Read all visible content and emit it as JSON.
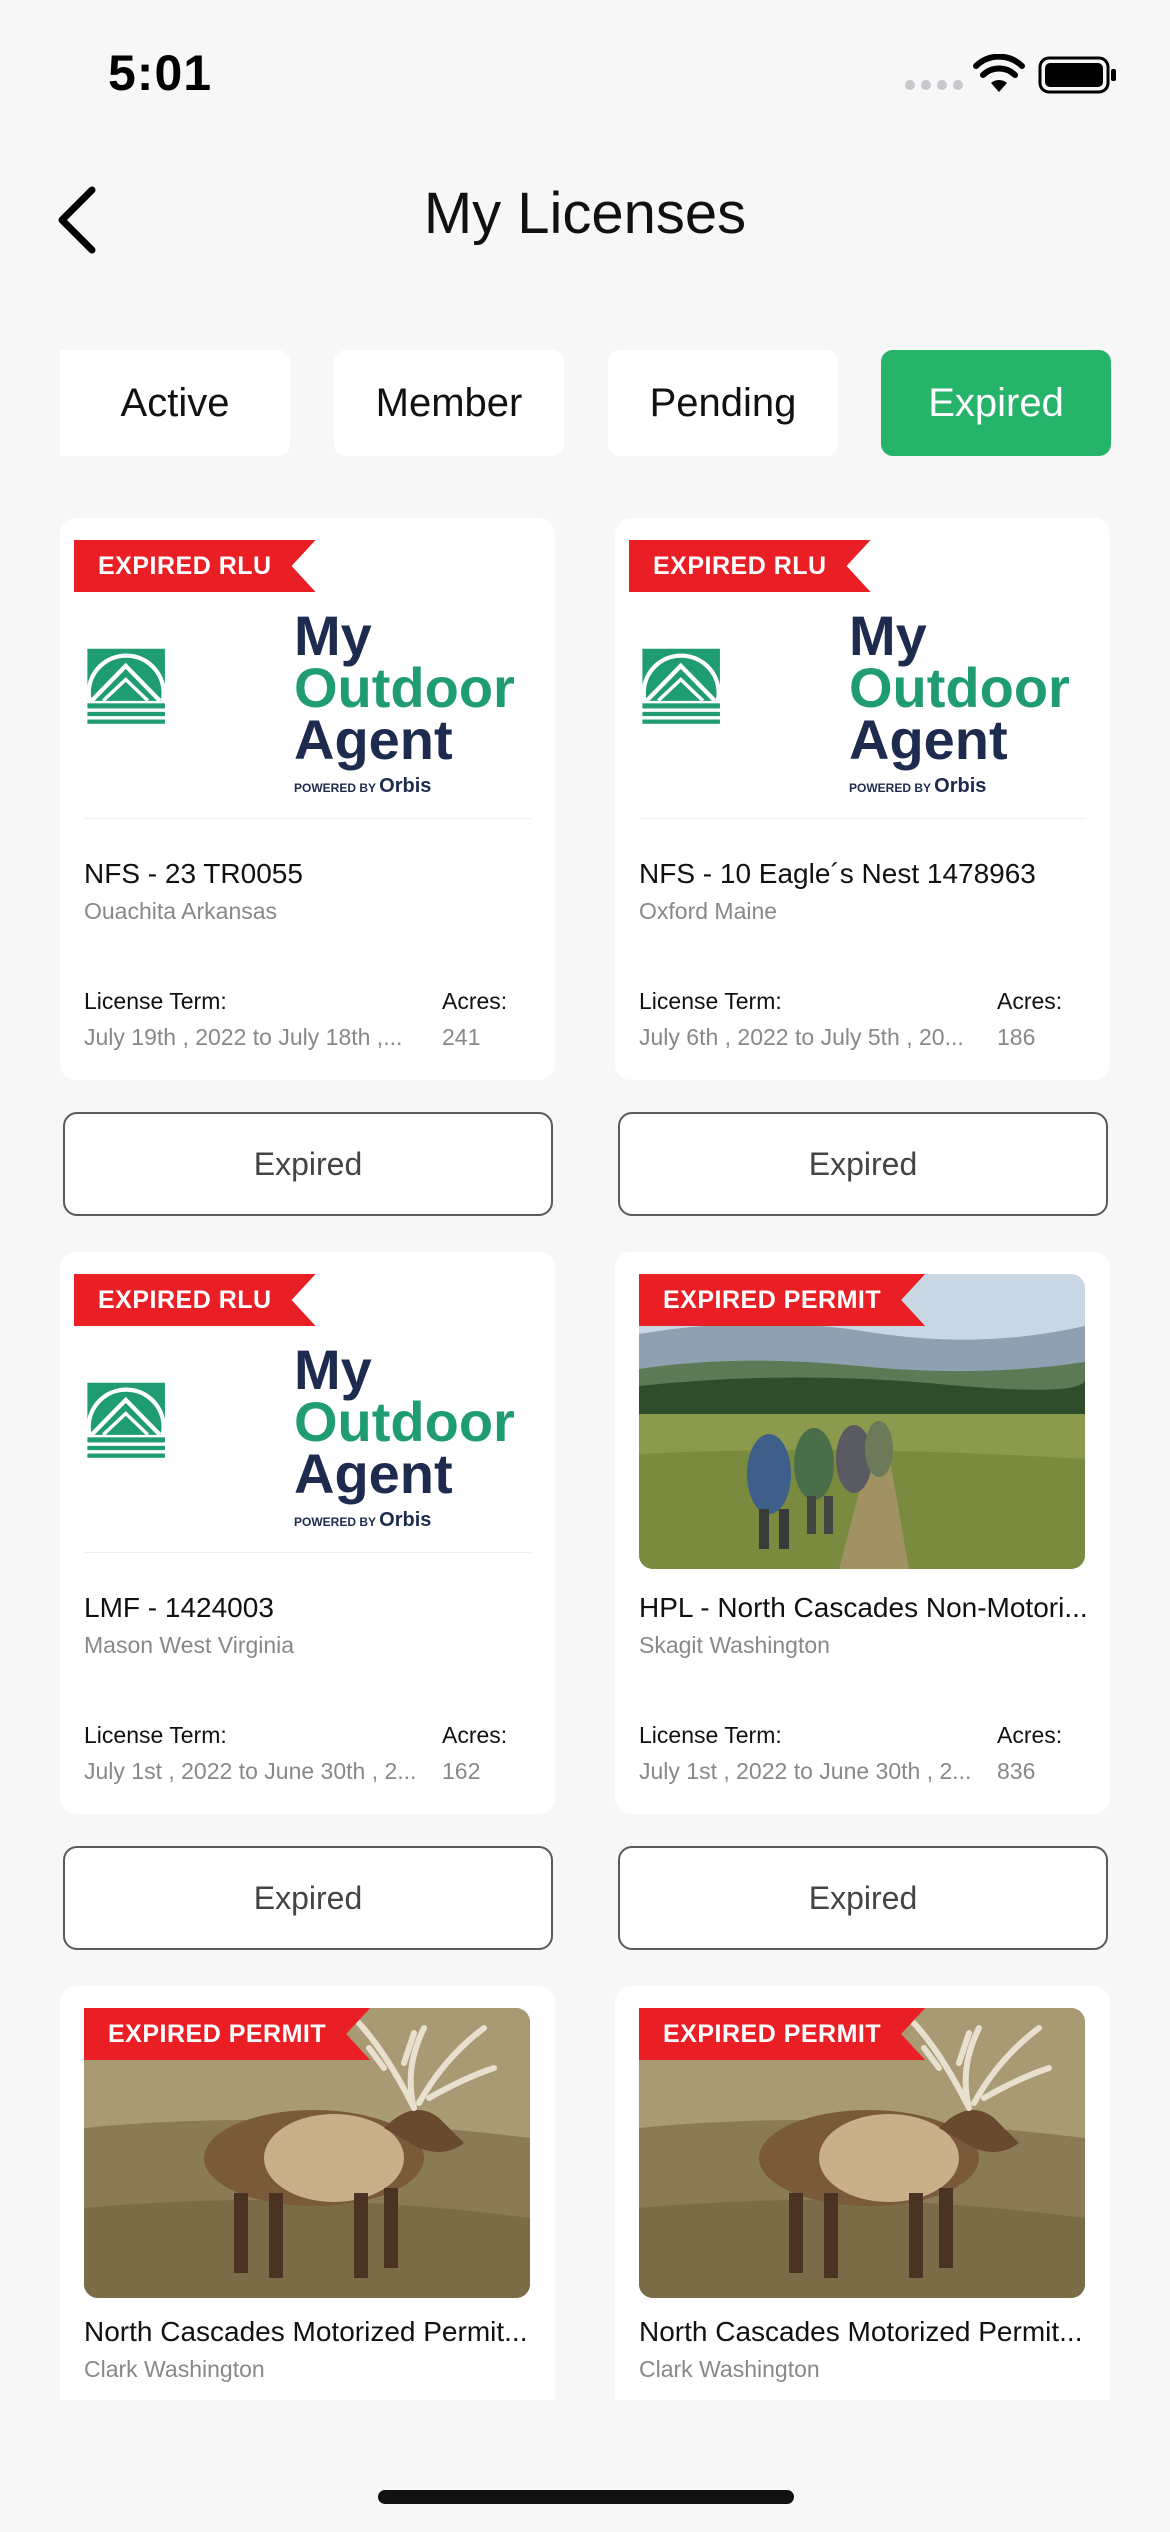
{
  "status_bar": {
    "time": "5:01"
  },
  "header": {
    "title": "My Licenses"
  },
  "tabs": [
    {
      "label": "Active"
    },
    {
      "label": "Member"
    },
    {
      "label": "Pending"
    },
    {
      "label": "Expired",
      "selected": true
    }
  ],
  "colors": {
    "accent": "#26b36a",
    "ribbon": "#ea1f25",
    "logo_green": "#1f9c74",
    "logo_navy": "#1d2b4f"
  },
  "logo": {
    "line1": "My",
    "line2": "Outdoor",
    "line3": "Agent",
    "powered": "POWERED BY",
    "brand": "Orbis"
  },
  "cards": [
    {
      "ribbon": "EXPIRED RLU",
      "image": "my-outdoor-agent-logo",
      "title": "NFS - 23 TR0055",
      "location": "Ouachita Arkansas",
      "term_label": "License Term:",
      "term": "July 19th , 2022 to July 18th ,...",
      "acres_label": "Acres:",
      "acres": "241",
      "status": "Expired"
    },
    {
      "ribbon": "EXPIRED RLU",
      "image": "my-outdoor-agent-logo",
      "title": "NFS - 10 Eagle´s Nest 1478963",
      "location": "Oxford Maine",
      "term_label": "License Term:",
      "term": "July 6th , 2022 to July 5th , 20...",
      "acres_label": "Acres:",
      "acres": "186",
      "status": "Expired"
    },
    {
      "ribbon": "EXPIRED RLU",
      "image": "my-outdoor-agent-logo",
      "title": "LMF - 1424003",
      "location": "Mason West Virginia",
      "term_label": "License Term:",
      "term": "July 1st , 2022 to June 30th , 2...",
      "acres_label": "Acres:",
      "acres": "162",
      "status": "Expired"
    },
    {
      "ribbon": "EXPIRED PERMIT",
      "image": "hikers-photo",
      "title": "HPL - North Cascades Non-Motori...",
      "location": "Skagit Washington",
      "term_label": "License Term:",
      "term": "July 1st , 2022 to June 30th , 2...",
      "acres_label": "Acres:",
      "acres": "836",
      "status": "Expired"
    },
    {
      "ribbon": "EXPIRED PERMIT",
      "image": "elk-photo",
      "title": "North Cascades Motorized Permit...",
      "location": "Clark Washington"
    },
    {
      "ribbon": "EXPIRED PERMIT",
      "image": "elk-photo",
      "title": "North Cascades Motorized Permit...",
      "location": "Clark Washington"
    }
  ]
}
